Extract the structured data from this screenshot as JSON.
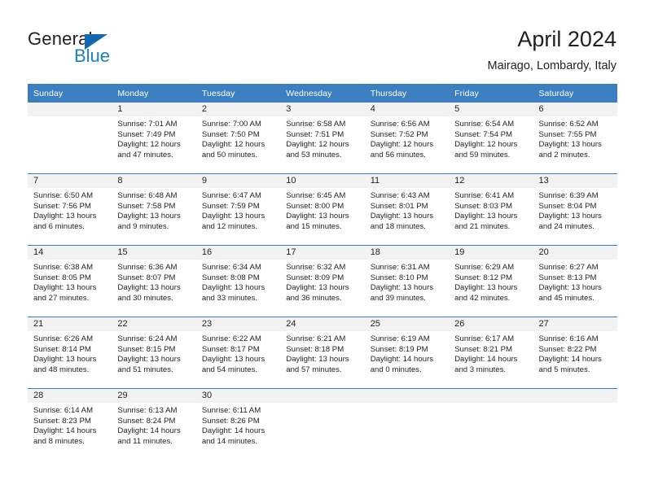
{
  "brand": {
    "name_part1": "General",
    "name_part2": "Blue",
    "triangle_color": "#1268b3",
    "blue_text_color": "#1e7fc4"
  },
  "header": {
    "title": "April 2024",
    "subtitle": "Mairago, Lombardy, Italy",
    "header_bg": "#3c7fc1",
    "header_text_color": "#ffffff"
  },
  "calendar": {
    "weekday_headers": [
      "Sunday",
      "Monday",
      "Tuesday",
      "Wednesday",
      "Thursday",
      "Friday",
      "Saturday"
    ],
    "weeks": [
      [
        {
          "day": "",
          "sunrise": "",
          "sunset": "",
          "daylight_line1": "",
          "daylight_line2": "",
          "empty": true
        },
        {
          "day": "1",
          "sunrise": "Sunrise: 7:01 AM",
          "sunset": "Sunset: 7:49 PM",
          "daylight_line1": "Daylight: 12 hours",
          "daylight_line2": "and 47 minutes.",
          "empty": false
        },
        {
          "day": "2",
          "sunrise": "Sunrise: 7:00 AM",
          "sunset": "Sunset: 7:50 PM",
          "daylight_line1": "Daylight: 12 hours",
          "daylight_line2": "and 50 minutes.",
          "empty": false
        },
        {
          "day": "3",
          "sunrise": "Sunrise: 6:58 AM",
          "sunset": "Sunset: 7:51 PM",
          "daylight_line1": "Daylight: 12 hours",
          "daylight_line2": "and 53 minutes.",
          "empty": false
        },
        {
          "day": "4",
          "sunrise": "Sunrise: 6:56 AM",
          "sunset": "Sunset: 7:52 PM",
          "daylight_line1": "Daylight: 12 hours",
          "daylight_line2": "and 56 minutes.",
          "empty": false
        },
        {
          "day": "5",
          "sunrise": "Sunrise: 6:54 AM",
          "sunset": "Sunset: 7:54 PM",
          "daylight_line1": "Daylight: 12 hours",
          "daylight_line2": "and 59 minutes.",
          "empty": false
        },
        {
          "day": "6",
          "sunrise": "Sunrise: 6:52 AM",
          "sunset": "Sunset: 7:55 PM",
          "daylight_line1": "Daylight: 13 hours",
          "daylight_line2": "and 2 minutes.",
          "empty": false
        }
      ],
      [
        {
          "day": "7",
          "sunrise": "Sunrise: 6:50 AM",
          "sunset": "Sunset: 7:56 PM",
          "daylight_line1": "Daylight: 13 hours",
          "daylight_line2": "and 6 minutes.",
          "empty": false
        },
        {
          "day": "8",
          "sunrise": "Sunrise: 6:48 AM",
          "sunset": "Sunset: 7:58 PM",
          "daylight_line1": "Daylight: 13 hours",
          "daylight_line2": "and 9 minutes.",
          "empty": false
        },
        {
          "day": "9",
          "sunrise": "Sunrise: 6:47 AM",
          "sunset": "Sunset: 7:59 PM",
          "daylight_line1": "Daylight: 13 hours",
          "daylight_line2": "and 12 minutes.",
          "empty": false
        },
        {
          "day": "10",
          "sunrise": "Sunrise: 6:45 AM",
          "sunset": "Sunset: 8:00 PM",
          "daylight_line1": "Daylight: 13 hours",
          "daylight_line2": "and 15 minutes.",
          "empty": false
        },
        {
          "day": "11",
          "sunrise": "Sunrise: 6:43 AM",
          "sunset": "Sunset: 8:01 PM",
          "daylight_line1": "Daylight: 13 hours",
          "daylight_line2": "and 18 minutes.",
          "empty": false
        },
        {
          "day": "12",
          "sunrise": "Sunrise: 6:41 AM",
          "sunset": "Sunset: 8:03 PM",
          "daylight_line1": "Daylight: 13 hours",
          "daylight_line2": "and 21 minutes.",
          "empty": false
        },
        {
          "day": "13",
          "sunrise": "Sunrise: 6:39 AM",
          "sunset": "Sunset: 8:04 PM",
          "daylight_line1": "Daylight: 13 hours",
          "daylight_line2": "and 24 minutes.",
          "empty": false
        }
      ],
      [
        {
          "day": "14",
          "sunrise": "Sunrise: 6:38 AM",
          "sunset": "Sunset: 8:05 PM",
          "daylight_line1": "Daylight: 13 hours",
          "daylight_line2": "and 27 minutes.",
          "empty": false
        },
        {
          "day": "15",
          "sunrise": "Sunrise: 6:36 AM",
          "sunset": "Sunset: 8:07 PM",
          "daylight_line1": "Daylight: 13 hours",
          "daylight_line2": "and 30 minutes.",
          "empty": false
        },
        {
          "day": "16",
          "sunrise": "Sunrise: 6:34 AM",
          "sunset": "Sunset: 8:08 PM",
          "daylight_line1": "Daylight: 13 hours",
          "daylight_line2": "and 33 minutes.",
          "empty": false
        },
        {
          "day": "17",
          "sunrise": "Sunrise: 6:32 AM",
          "sunset": "Sunset: 8:09 PM",
          "daylight_line1": "Daylight: 13 hours",
          "daylight_line2": "and 36 minutes.",
          "empty": false
        },
        {
          "day": "18",
          "sunrise": "Sunrise: 6:31 AM",
          "sunset": "Sunset: 8:10 PM",
          "daylight_line1": "Daylight: 13 hours",
          "daylight_line2": "and 39 minutes.",
          "empty": false
        },
        {
          "day": "19",
          "sunrise": "Sunrise: 6:29 AM",
          "sunset": "Sunset: 8:12 PM",
          "daylight_line1": "Daylight: 13 hours",
          "daylight_line2": "and 42 minutes.",
          "empty": false
        },
        {
          "day": "20",
          "sunrise": "Sunrise: 6:27 AM",
          "sunset": "Sunset: 8:13 PM",
          "daylight_line1": "Daylight: 13 hours",
          "daylight_line2": "and 45 minutes.",
          "empty": false
        }
      ],
      [
        {
          "day": "21",
          "sunrise": "Sunrise: 6:26 AM",
          "sunset": "Sunset: 8:14 PM",
          "daylight_line1": "Daylight: 13 hours",
          "daylight_line2": "and 48 minutes.",
          "empty": false
        },
        {
          "day": "22",
          "sunrise": "Sunrise: 6:24 AM",
          "sunset": "Sunset: 8:15 PM",
          "daylight_line1": "Daylight: 13 hours",
          "daylight_line2": "and 51 minutes.",
          "empty": false
        },
        {
          "day": "23",
          "sunrise": "Sunrise: 6:22 AM",
          "sunset": "Sunset: 8:17 PM",
          "daylight_line1": "Daylight: 13 hours",
          "daylight_line2": "and 54 minutes.",
          "empty": false
        },
        {
          "day": "24",
          "sunrise": "Sunrise: 6:21 AM",
          "sunset": "Sunset: 8:18 PM",
          "daylight_line1": "Daylight: 13 hours",
          "daylight_line2": "and 57 minutes.",
          "empty": false
        },
        {
          "day": "25",
          "sunrise": "Sunrise: 6:19 AM",
          "sunset": "Sunset: 8:19 PM",
          "daylight_line1": "Daylight: 14 hours",
          "daylight_line2": "and 0 minutes.",
          "empty": false
        },
        {
          "day": "26",
          "sunrise": "Sunrise: 6:17 AM",
          "sunset": "Sunset: 8:21 PM",
          "daylight_line1": "Daylight: 14 hours",
          "daylight_line2": "and 3 minutes.",
          "empty": false
        },
        {
          "day": "27",
          "sunrise": "Sunrise: 6:16 AM",
          "sunset": "Sunset: 8:22 PM",
          "daylight_line1": "Daylight: 14 hours",
          "daylight_line2": "and 5 minutes.",
          "empty": false
        }
      ],
      [
        {
          "day": "28",
          "sunrise": "Sunrise: 6:14 AM",
          "sunset": "Sunset: 8:23 PM",
          "daylight_line1": "Daylight: 14 hours",
          "daylight_line2": "and 8 minutes.",
          "empty": false
        },
        {
          "day": "29",
          "sunrise": "Sunrise: 6:13 AM",
          "sunset": "Sunset: 8:24 PM",
          "daylight_line1": "Daylight: 14 hours",
          "daylight_line2": "and 11 minutes.",
          "empty": false
        },
        {
          "day": "30",
          "sunrise": "Sunrise: 6:11 AM",
          "sunset": "Sunset: 8:26 PM",
          "daylight_line1": "Daylight: 14 hours",
          "daylight_line2": "and 14 minutes.",
          "empty": false
        },
        {
          "day": "",
          "sunrise": "",
          "sunset": "",
          "daylight_line1": "",
          "daylight_line2": "",
          "empty": true
        },
        {
          "day": "",
          "sunrise": "",
          "sunset": "",
          "daylight_line1": "",
          "daylight_line2": "",
          "empty": true
        },
        {
          "day": "",
          "sunrise": "",
          "sunset": "",
          "daylight_line1": "",
          "daylight_line2": "",
          "empty": true
        },
        {
          "day": "",
          "sunrise": "",
          "sunset": "",
          "daylight_line1": "",
          "daylight_line2": "",
          "empty": true
        }
      ]
    ]
  }
}
